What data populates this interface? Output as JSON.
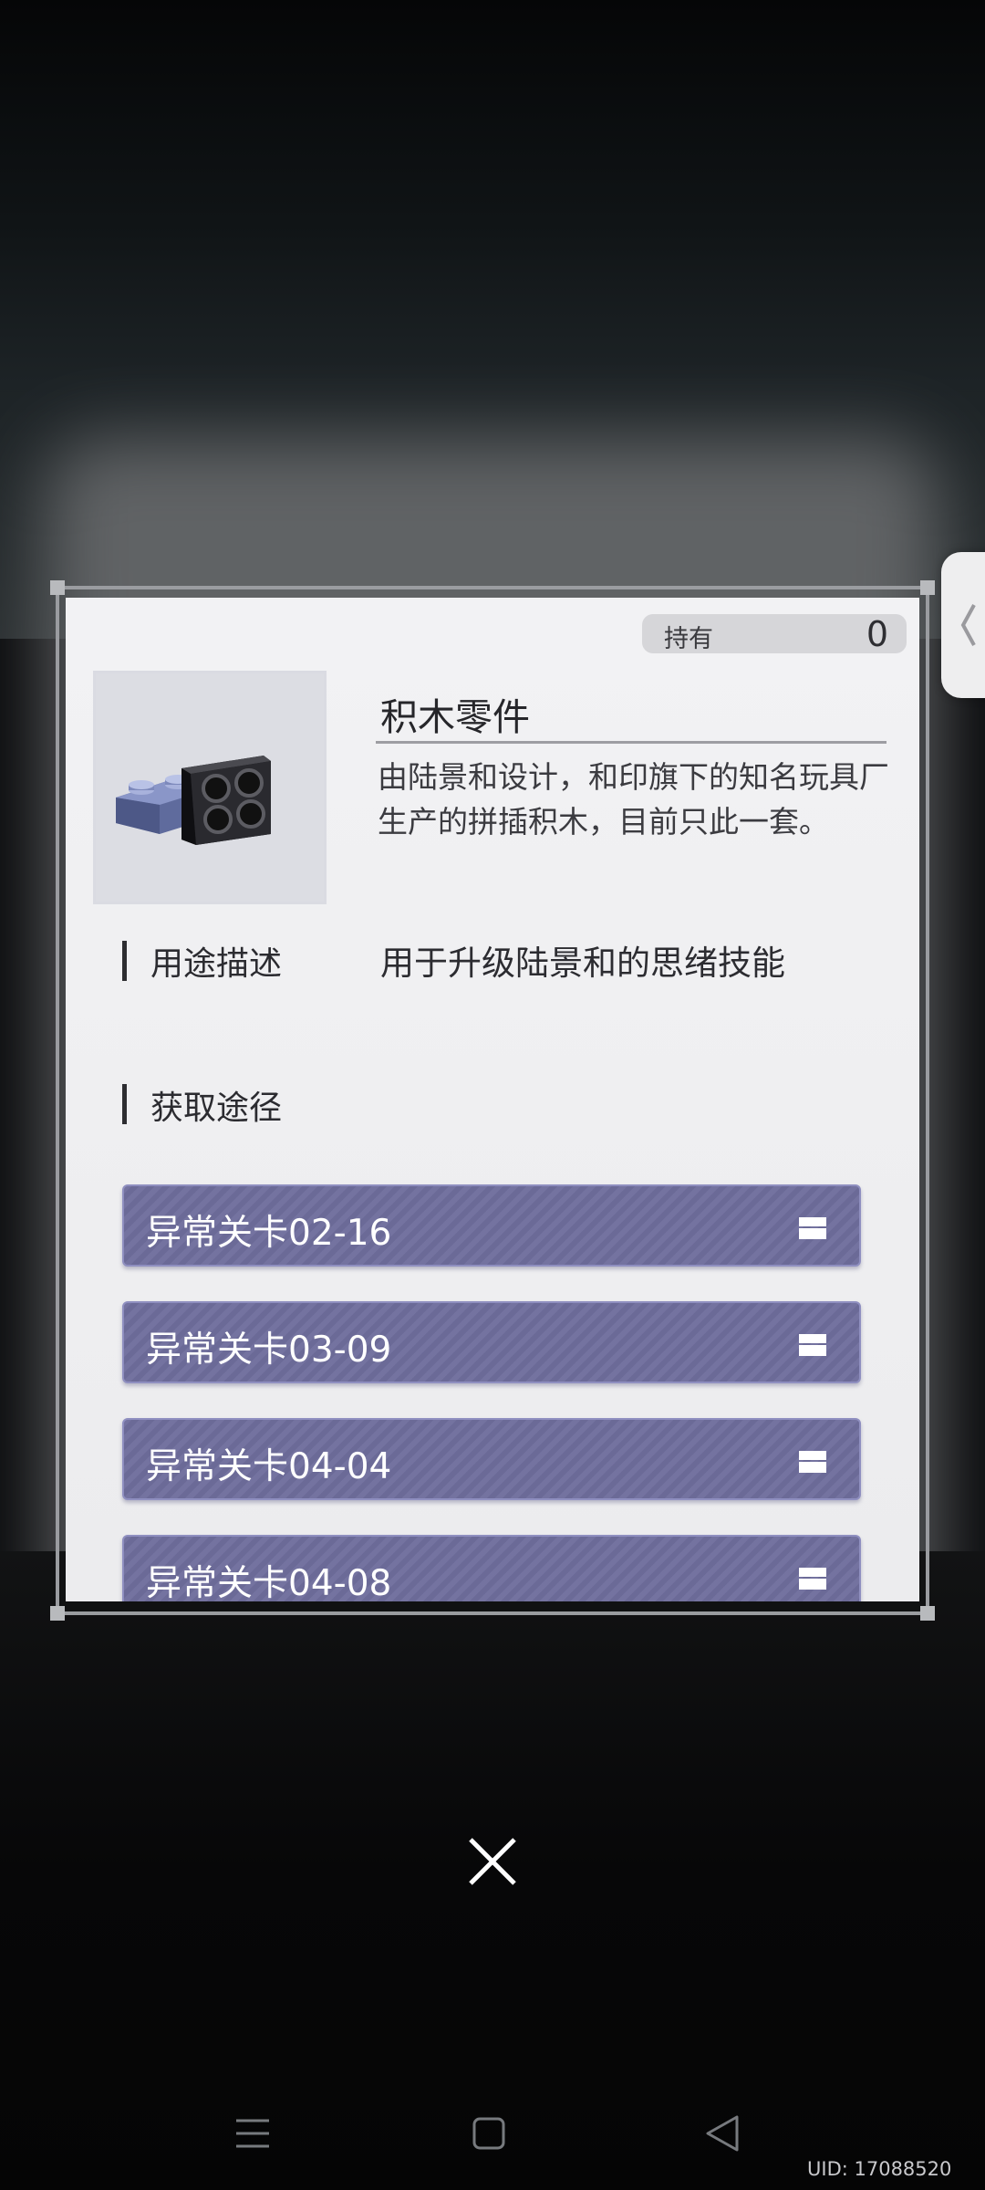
{
  "item": {
    "owned_label": "持有",
    "owned_count": "0",
    "name": "积木零件",
    "description": "由陆景和设计，和印旗下的知名玩具厂生产的拼插积木，目前只此一套。"
  },
  "usage": {
    "title": "用途描述",
    "text": "用于升级陆景和的思绪技能"
  },
  "acquire": {
    "title": "获取途径",
    "routes": [
      {
        "label": "异常关卡02-16"
      },
      {
        "label": "异常关卡03-09"
      },
      {
        "label": "异常关卡04-04"
      },
      {
        "label": "异常关卡04-08"
      }
    ]
  },
  "footer": {
    "uid": "UID: 17088520"
  },
  "icons": {
    "side_tab": "chevron-left-icon",
    "close": "close-icon",
    "route": "lock-icon",
    "nav": [
      "menu-icon",
      "home-square-icon",
      "back-triangle-icon"
    ]
  },
  "colors": {
    "route_bg": "#6e6d9c",
    "panel_bg": "#f0f0f2"
  }
}
